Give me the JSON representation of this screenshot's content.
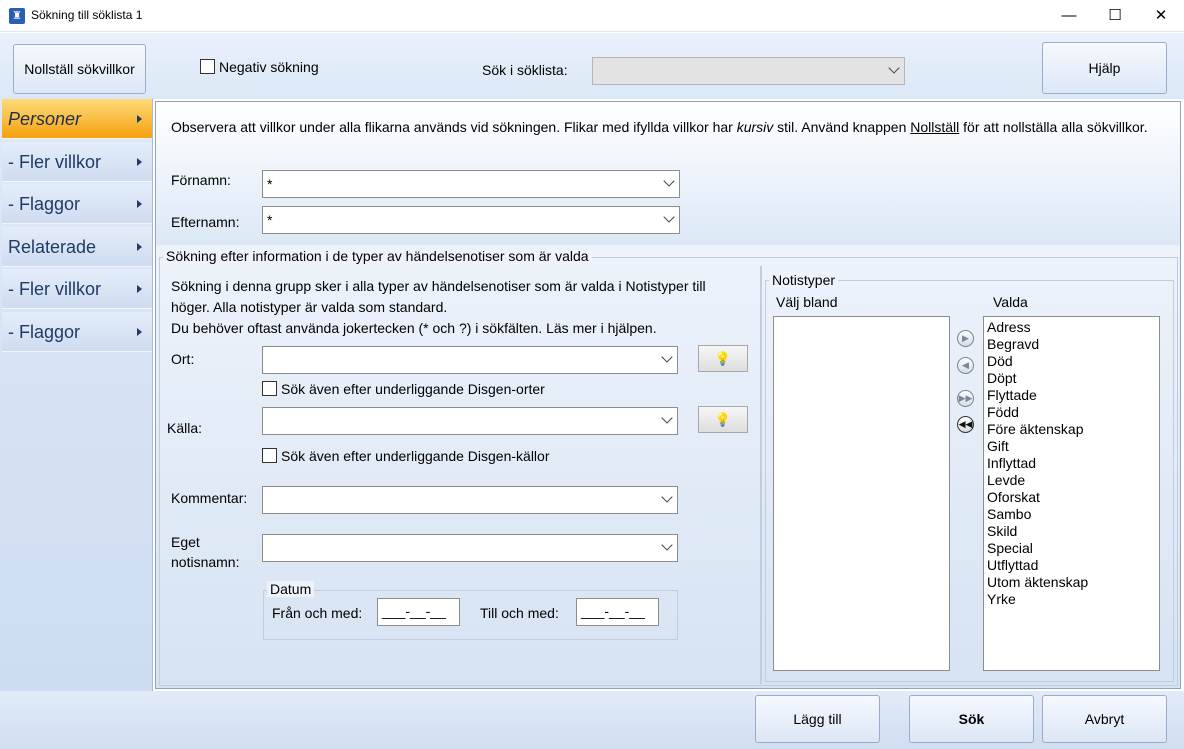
{
  "window": {
    "title": "Sökning till söklista 1",
    "minimize": "—",
    "maximize": "☐",
    "close": "✕"
  },
  "toolbar": {
    "reset_label": "Nollställ sökvillkor",
    "negative_search_label": "Negativ sökning",
    "search_in_list_label": "Sök i söklista:",
    "search_in_list_value": "",
    "help_label": "Hjälp"
  },
  "sidebar": {
    "items": [
      {
        "label": "Personer",
        "active": true
      },
      {
        "label": "- Fler villkor",
        "active": false
      },
      {
        "label": "- Flaggor",
        "active": false
      },
      {
        "label": "Relaterade",
        "active": false
      },
      {
        "label": "- Fler villkor",
        "active": false
      },
      {
        "label": "- Flaggor",
        "active": false
      }
    ]
  },
  "info": {
    "text_part1": "Observera att villkor under alla flikarna används vid sökningen. Flikar med ifyllda villkor har ",
    "text_italic": "kursiv",
    "text_part2": " stil. Använd knappen ",
    "text_link": "Nollställ",
    "text_part3": " för att nollställa alla sökvillkor."
  },
  "name_fields": {
    "first_name_label": "Förnamn:",
    "first_name_value": "*",
    "last_name_label": "Efternamn:",
    "last_name_value": "*"
  },
  "event_group": {
    "title": "Sökning efter information i de typer av händelsenotiser som är valda",
    "description_line1": "Sökning i denna grupp sker i alla typer av händelsenotiser som är valda i Notistyper till",
    "description_line2": "höger. Alla notistyper är valda som standard.",
    "description_line3": "Du behöver oftast använda jokertecken (* och ?) i sökfälten. Läs mer i hjälpen.",
    "place_label": "Ort:",
    "place_value": "",
    "place_sub_label": "Sök även efter underliggande Disgen-orter",
    "source_label": "Källa:",
    "source_value": "",
    "source_sub_label": "Sök även efter underliggande Disgen-källor",
    "comment_label": "Kommentar:",
    "comment_value": "",
    "own_name_label_line1": "Eget",
    "own_name_label_line2": "notisnamn:",
    "own_name_value": "",
    "date_group_title": "Datum",
    "from_label": "Från och med:",
    "from_value": "___-__-__",
    "to_label": "Till och med:",
    "to_value": "___-__-__"
  },
  "note_types": {
    "title": "Notistyper",
    "available_label": "Välj bland",
    "selected_label": "Valda",
    "available_items": [],
    "selected_items": [
      "Adress",
      "Begravd",
      "Död",
      "Döpt",
      "Flyttade",
      "Född",
      "Före äktenskap",
      "Gift",
      "Inflyttad",
      "Levde",
      "Oforskat",
      "Sambo",
      "Skild",
      "Special",
      "Utflyttad",
      "Utom äktenskap",
      "Yrke"
    ]
  },
  "bottom": {
    "add_label": "Lägg till",
    "search_label": "Sök",
    "cancel_label": "Avbryt"
  },
  "icons": {
    "app": "app-icon",
    "lightbulb": "lightbulb-icon"
  }
}
